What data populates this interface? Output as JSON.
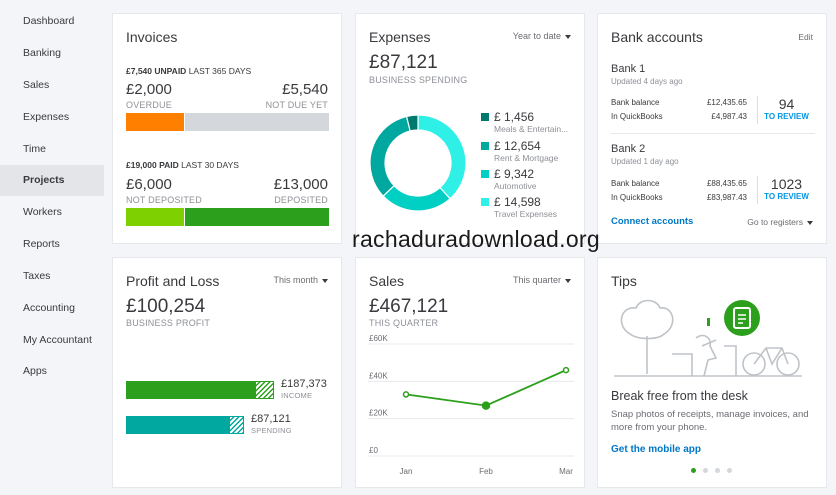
{
  "sidebar": {
    "items": [
      "Dashboard",
      "Banking",
      "Sales",
      "Expenses",
      "Time",
      "Projects",
      "Workers",
      "Reports",
      "Taxes",
      "Accounting",
      "My Accountant",
      "Apps"
    ],
    "active": "Projects"
  },
  "invoices": {
    "title": "Invoices",
    "unpaid_amount": "£7,540 UNPAID",
    "unpaid_period": "LAST 365 DAYS",
    "overdue_value": "£2,000",
    "overdue_label": "OVERDUE",
    "not_due_value": "£5,540",
    "not_due_label": "NOT DUE YET",
    "paid_amount": "£19,000 PAID",
    "paid_period": "LAST 30 DAYS",
    "not_deposited_value": "£6,000",
    "not_deposited_label": "NOT DEPOSITED",
    "deposited_value": "£13,000",
    "deposited_label": "DEPOSITED"
  },
  "expenses": {
    "title": "Expenses",
    "period": "Year to date",
    "total": "£87,121",
    "total_label": "BUSINESS SPENDING",
    "categories": [
      {
        "value": "£ 1,456",
        "label": "Meals & Entertain...",
        "color": "#00786e",
        "amount": 1456
      },
      {
        "value": "£ 12,654",
        "label": "Rent & Mortgage",
        "color": "#00a8a0",
        "amount": 12654
      },
      {
        "value": "£ 9,342",
        "label": "Automotive",
        "color": "#00cfc4",
        "amount": 9342
      },
      {
        "value": "£ 14,598",
        "label": "Travel Expenses",
        "color": "#2ef0e6",
        "amount": 14598
      }
    ]
  },
  "bank": {
    "title": "Bank accounts",
    "edit": "Edit",
    "accounts": [
      {
        "name": "Bank 1",
        "updated": "Updated 4 days ago",
        "balance_label": "Bank balance",
        "balance": "£12,435.65",
        "qb_label": "In QuickBooks",
        "qb": "£4,987.43",
        "count": "94",
        "review": "TO REVIEW"
      },
      {
        "name": "Bank 2",
        "updated": "Updated 1 day ago",
        "balance_label": "Bank balance",
        "balance": "£88,435.65",
        "qb_label": "In QuickBooks",
        "qb": "£83,987.43",
        "count": "1023",
        "review": "TO REVIEW"
      }
    ],
    "connect": "Connect accounts",
    "goto": "Go to registers"
  },
  "pnl": {
    "title": "Profit and Loss",
    "period": "This month",
    "total": "£100,254",
    "total_label": "BUSINESS PROFIT",
    "income_value": "£187,373",
    "income_label": "INCOME",
    "spending_value": "£87,121",
    "spending_label": "SPENDING",
    "income_fill": 0.87,
    "spending_fill": 0.87
  },
  "sales": {
    "title": "Sales",
    "period": "This quarter",
    "total": "£467,121",
    "total_label": "THIS QUARTER"
  },
  "chart_data": {
    "type": "line",
    "categories": [
      "Jan",
      "Feb",
      "Mar"
    ],
    "values": [
      33000,
      27000,
      46000
    ],
    "yticks": [
      "£60K",
      "£40K",
      "£20K",
      "£0"
    ],
    "ylim": [
      0,
      60000
    ],
    "color": "#2ca01c"
  },
  "tips": {
    "title": "Tips",
    "headline": "Break free from the desk",
    "body": "Snap photos of receipts, manage invoices, and more from your phone.",
    "link": "Get the mobile app"
  },
  "watermark": "rachaduradownload.org",
  "colors": {
    "orange": "#ff8000",
    "grey": "#d4d7dc",
    "light_green": "#7fd000",
    "green": "#2ca01c",
    "teal": "#00a8a0"
  }
}
